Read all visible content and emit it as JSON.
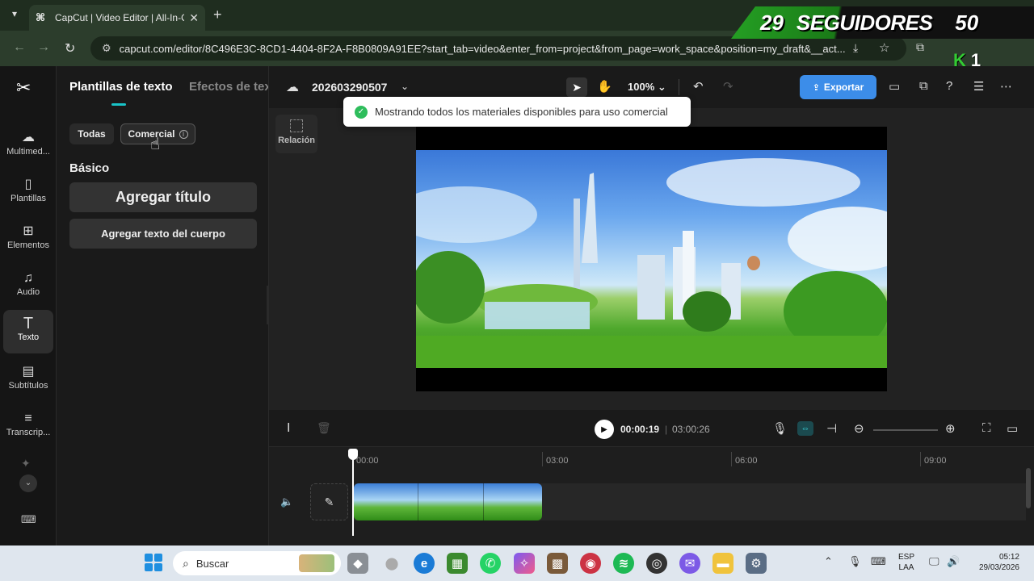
{
  "browser": {
    "tab_title": "CapCut | Video Editor | All-In-O",
    "tab_close": "✕",
    "new_tab": "+",
    "url": "capcut.com/editor/8C496E3C-8CD1-4404-8F2A-F8B0809A91EE?start_tab=video&enter_from=project&from_page=work_space&position=my_draft&__act..."
  },
  "overlay": {
    "count1": "29",
    "word": "SEGUIDORES",
    "count2": "50",
    "badge_letter": "K",
    "badge_num": "1"
  },
  "rail": {
    "items": [
      {
        "label": "Multimed...",
        "icon": "☁"
      },
      {
        "label": "Plantillas",
        "icon": "▯"
      },
      {
        "label": "Elementos",
        "icon": "⊞"
      },
      {
        "label": "Audio",
        "icon": "♫"
      },
      {
        "label": "Texto",
        "icon": "T"
      },
      {
        "label": "Subtítulos",
        "icon": "▤"
      },
      {
        "label": "Transcrip...",
        "icon": "≡"
      }
    ]
  },
  "panel": {
    "tab_active": "Plantillas de texto",
    "tab_other": "Efectos de tex",
    "filter_all": "Todas",
    "filter_commercial": "Comercial",
    "section": "Básico",
    "btn_title": "Agregar título",
    "btn_body": "Agregar texto del cuerpo"
  },
  "header": {
    "project_name": "202603290507",
    "zoom": "100%",
    "export": "Exportar"
  },
  "preview": {
    "ratio_label": "Relación",
    "toast": "Mostrando todos los materiales disponibles para uso comercial"
  },
  "timeline": {
    "current_time": "00:00:19",
    "separator": "|",
    "total_time": "03:00:26",
    "ruler": [
      "00:00",
      "03:00",
      "06:00",
      "09:00"
    ]
  },
  "taskbar": {
    "search": "Buscar",
    "lang1": "ESP",
    "lang2": "LAA",
    "time": "05:12",
    "date": "29/03/2026"
  },
  "colors": {
    "accent": "#19c4c8",
    "export": "#3c8de9",
    "toast_check": "#2ebd5c"
  }
}
